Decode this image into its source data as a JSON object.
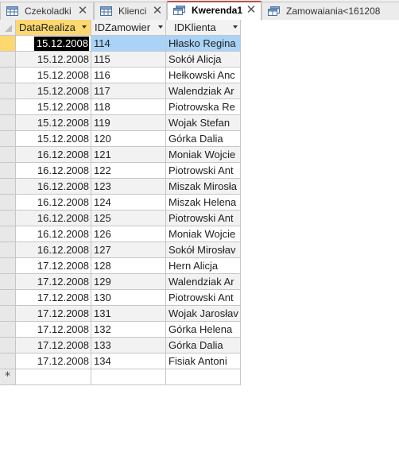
{
  "tabs": [
    {
      "label": "Czekoladki",
      "icon": "table-icon",
      "active": false
    },
    {
      "label": "Klienci",
      "icon": "table-icon",
      "active": false
    },
    {
      "label": "Kwerenda1",
      "icon": "query-icon",
      "active": true
    },
    {
      "label": "Zamowaiania<161208",
      "icon": "query-icon",
      "active": false
    }
  ],
  "columns": [
    {
      "label": "DataRealiza",
      "sorted": true
    },
    {
      "label": "IDZamowier",
      "sorted": false
    },
    {
      "label": "IDKlienta",
      "sorted": false
    }
  ],
  "rows": [
    {
      "date": "15.12.2008",
      "id": "114",
      "klient": "Hłasko Regina"
    },
    {
      "date": "15.12.2008",
      "id": "115",
      "klient": "Sokół Alicja"
    },
    {
      "date": "15.12.2008",
      "id": "116",
      "klient": "Hełkowski Anc"
    },
    {
      "date": "15.12.2008",
      "id": "117",
      "klient": "Walendziak Ar"
    },
    {
      "date": "15.12.2008",
      "id": "118",
      "klient": "Piotrowska Re"
    },
    {
      "date": "15.12.2008",
      "id": "119",
      "klient": "Wojak Stefan"
    },
    {
      "date": "15.12.2008",
      "id": "120",
      "klient": "Górka Dalia"
    },
    {
      "date": "16.12.2008",
      "id": "121",
      "klient": "Moniak Wojcie"
    },
    {
      "date": "16.12.2008",
      "id": "122",
      "klient": "Piotrowski Ant"
    },
    {
      "date": "16.12.2008",
      "id": "123",
      "klient": "Miszak Mirosła"
    },
    {
      "date": "16.12.2008",
      "id": "124",
      "klient": "Miszak Helena"
    },
    {
      "date": "16.12.2008",
      "id": "125",
      "klient": "Piotrowski Ant"
    },
    {
      "date": "16.12.2008",
      "id": "126",
      "klient": "Moniak Wojcie"
    },
    {
      "date": "16.12.2008",
      "id": "127",
      "klient": "Sokół Mirosłav"
    },
    {
      "date": "17.12.2008",
      "id": "128",
      "klient": "Hern Alicja"
    },
    {
      "date": "17.12.2008",
      "id": "129",
      "klient": "Walendziak Ar"
    },
    {
      "date": "17.12.2008",
      "id": "130",
      "klient": "Piotrowski Ant"
    },
    {
      "date": "17.12.2008",
      "id": "131",
      "klient": "Wojak Jarosłav"
    },
    {
      "date": "17.12.2008",
      "id": "132",
      "klient": "Górka Helena"
    },
    {
      "date": "17.12.2008",
      "id": "133",
      "klient": "Górka Dalia"
    },
    {
      "date": "17.12.2008",
      "id": "134",
      "klient": "Fisiak Antoni"
    }
  ],
  "new_row_marker": "*",
  "close_glyph": "✕",
  "colors": {
    "active_tab_accent": "#c0504d",
    "sorted_header": "#fcd86f",
    "selection": "#a9d3f7",
    "gridline": "#c6c6c6"
  }
}
